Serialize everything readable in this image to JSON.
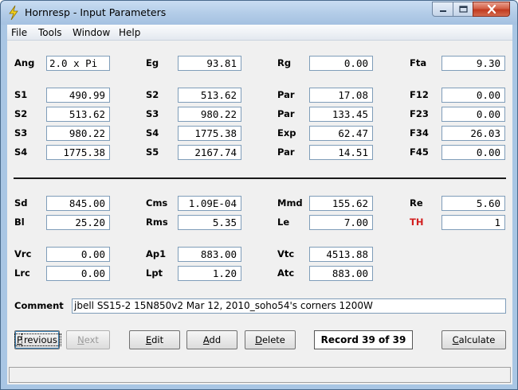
{
  "window": {
    "title": "Hornresp - Input Parameters",
    "icon": "lightning-bolt-icon",
    "controls": [
      "minimize-icon",
      "maximize-icon",
      "close-icon"
    ]
  },
  "menu": [
    "File",
    "Tools",
    "Window",
    "Help"
  ],
  "params": {
    "ang": {
      "label": "Ang",
      "value": "2.0 x Pi"
    },
    "eg": {
      "label": "Eg",
      "value": "93.81"
    },
    "rg": {
      "label": "Rg",
      "value": "0.00"
    },
    "fta": {
      "label": "Fta",
      "value": "9.30"
    },
    "s1": {
      "label": "S1",
      "value": "490.99"
    },
    "s2a": {
      "label": "S2",
      "value": "513.62"
    },
    "par1": {
      "label": "Par",
      "value": "17.08"
    },
    "f12": {
      "label": "F12",
      "value": "0.00"
    },
    "s2b": {
      "label": "S2",
      "value": "513.62"
    },
    "s3a": {
      "label": "S3",
      "value": "980.22"
    },
    "par2": {
      "label": "Par",
      "value": "133.45"
    },
    "f23": {
      "label": "F23",
      "value": "0.00"
    },
    "s3b": {
      "label": "S3",
      "value": "980.22"
    },
    "s4a": {
      "label": "S4",
      "value": "1775.38"
    },
    "exp": {
      "label": "Exp",
      "value": "62.47"
    },
    "f34": {
      "label": "F34",
      "value": "26.03"
    },
    "s4b": {
      "label": "S4",
      "value": "1775.38"
    },
    "s5": {
      "label": "S5",
      "value": "2167.74"
    },
    "par3": {
      "label": "Par",
      "value": "14.51"
    },
    "f45": {
      "label": "F45",
      "value": "0.00"
    },
    "sd": {
      "label": "Sd",
      "value": "845.00"
    },
    "cms": {
      "label": "Cms",
      "value": "1.09E-04"
    },
    "mmd": {
      "label": "Mmd",
      "value": "155.62"
    },
    "re": {
      "label": "Re",
      "value": "5.60"
    },
    "bl": {
      "label": "Bl",
      "value": "25.20"
    },
    "rms": {
      "label": "Rms",
      "value": "5.35"
    },
    "le": {
      "label": "Le",
      "value": "7.00"
    },
    "th": {
      "label": "TH",
      "value": "1"
    },
    "vrc": {
      "label": "Vrc",
      "value": "0.00"
    },
    "ap1": {
      "label": "Ap1",
      "value": "883.00"
    },
    "vtc": {
      "label": "Vtc",
      "value": "4513.88"
    },
    "lrc": {
      "label": "Lrc",
      "value": "0.00"
    },
    "lpt": {
      "label": "Lpt",
      "value": "1.20"
    },
    "atc": {
      "label": "Atc",
      "value": "883.00"
    }
  },
  "comment": {
    "label": "Comment",
    "value": "jbell SS15-2 15N850v2 Mar 12, 2010_soho54's corners 1200W"
  },
  "buttons": {
    "previous": {
      "u": "P",
      "rest": "revious"
    },
    "next": {
      "u": "N",
      "rest": "ext"
    },
    "edit": {
      "u": "E",
      "rest": "dit"
    },
    "add": {
      "u": "A",
      "rest": "dd"
    },
    "delete": {
      "u": "D",
      "rest": "elete"
    },
    "calculate": {
      "u": "C",
      "rest": "alculate"
    }
  },
  "record": "Record 39 of 39",
  "colors": {
    "th_label": "#d21f1f",
    "title_bar": "#b4cde8",
    "close_button": "#c13a1f"
  }
}
